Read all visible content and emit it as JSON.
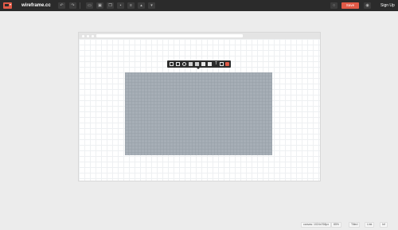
{
  "app": {
    "name": "wireframe.cc"
  },
  "toolbar": {
    "save_label": "Save",
    "signup_label": "Sign Up",
    "tools": [
      "undo-icon",
      "redo-icon",
      "rect-tool-icon",
      "group-icon",
      "copy-icon",
      "paste-icon",
      "lock-icon",
      "align-icon",
      "bring-front-icon",
      "send-back-icon"
    ]
  },
  "floating_toolbar": {
    "text_tool": "T",
    "tools": [
      "rectangle-icon",
      "panel-icon",
      "circle-icon",
      "image-icon",
      "image-alt-icon",
      "fill-icon",
      "text-icon",
      "line-icon",
      "delete-icon"
    ]
  },
  "statusbar": {
    "canvas_label": "canvas: 1024x768px",
    "zoom_label": "85%",
    "hint_label": "Tilted",
    "link_label": "Link",
    "info_label": "Inf"
  },
  "colors": {
    "topbar": "#2b2b2b",
    "accent": "#e05a47",
    "placeholder": "#a6aeb6",
    "canvas_bg": "#ececec"
  }
}
